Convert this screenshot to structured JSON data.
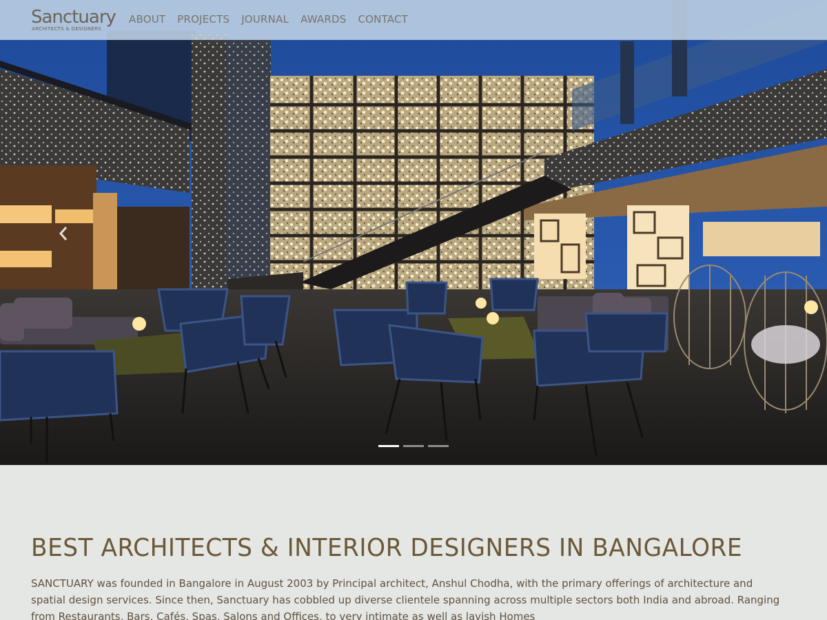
{
  "brand": {
    "name": "Sanctuary",
    "tagline": "ARCHITECTS & DESIGNERS"
  },
  "nav": {
    "items": [
      {
        "label": "ABOUT"
      },
      {
        "label": "PROJECTS"
      },
      {
        "label": "JOURNAL"
      },
      {
        "label": "AWARDS"
      },
      {
        "label": "CONTACT"
      }
    ]
  },
  "carousel": {
    "slide_count": 3,
    "active_index": 0,
    "prev_icon": "chevron-left-icon"
  },
  "main": {
    "heading": "BEST ARCHITECTS & INTERIOR DESIGNERS IN BANGALORE",
    "intro": "SANCTUARY was founded in Bangalore in August 2003 by Principal architect, Anshul Chodha, with the primary offerings of architecture and spatial design services. Since then, Sanctuary has cobbled up diverse clientele spanning across multiple sectors both India and abroad. Ranging from Restaurants, Bars, Cafés, Spas, Salons and Offices, to very intimate as well as lavish Homes"
  },
  "colors": {
    "nav_bg": "#c4d6e8",
    "nav_text": "#7a7468",
    "heading": "#6b5838",
    "body_text": "#5e5140",
    "page_bg": "#e5e7e4"
  }
}
